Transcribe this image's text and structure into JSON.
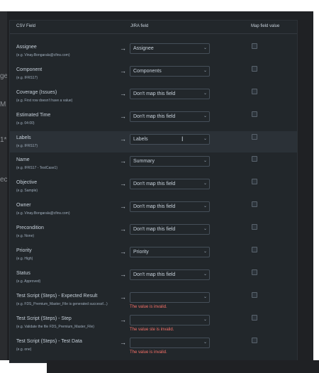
{
  "header": {
    "csv_field": "CSV Field",
    "jira_field": "JIRA field",
    "map_value": "Map field value"
  },
  "background_text": [
    "ge",
    "M",
    "1*",
    "ec"
  ],
  "arrow_glyph": "→",
  "chevron_glyph": "⌄",
  "rows": [
    {
      "label": "Assignee",
      "example": "(e.g. Vinay.Bongarala@cfins.com)",
      "value": "Assignee",
      "error": "",
      "checked": false
    },
    {
      "label": "Component",
      "example": "(e.g. IFRS17)",
      "value": "Components",
      "error": "",
      "checked": false
    },
    {
      "label": "Coverage (Issues)",
      "example": "(e.g. First row doesn't have a value)",
      "value": "Don't map this field",
      "error": "",
      "checked": false
    },
    {
      "label": "Estimated Time",
      "example": "(e.g. 04:00)",
      "value": "Don't map this field",
      "error": "",
      "checked": false
    },
    {
      "label": "Labels",
      "example": "(e.g. IFRS17)",
      "value": "Labels",
      "error": "",
      "checked": false
    },
    {
      "label": "Name",
      "example": "(e.g. IFRS17 - TestCase1)",
      "value": "Summary",
      "error": "",
      "checked": false
    },
    {
      "label": "Objective",
      "example": "(e.g. Sample)",
      "value": "Don't map this field",
      "error": "",
      "checked": false
    },
    {
      "label": "Owner",
      "example": "(e.g. Vinay.Bongarala@cfins.com)",
      "value": "Don't map this field",
      "error": "",
      "checked": false
    },
    {
      "label": "Precondition",
      "example": "(e.g. None)",
      "value": "Don't map this field",
      "error": "",
      "checked": false
    },
    {
      "label": "Priority",
      "example": "(e.g. High)",
      "value": "Priority",
      "error": "",
      "checked": false
    },
    {
      "label": "Status",
      "example": "(e.g. Approved)",
      "value": "Don't map this field",
      "error": "",
      "checked": false
    },
    {
      "label": "Test Script (Steps) - Expected Result",
      "example": "(e.g. FDS_Premium_Master_File is generated successf...)",
      "value": "",
      "error": "The value is invalid.",
      "checked": false
    },
    {
      "label": "Test Script (Steps) - Step",
      "example": "(e.g. Validate the file FDS_Premium_Master_File)",
      "value": "",
      "error": "The value ste is invalid.",
      "checked": false
    },
    {
      "label": "Test Script (Steps) - Test Data",
      "example": "(e.g. one)",
      "value": "",
      "error": "The value is invalid.",
      "checked": false
    }
  ],
  "colors": {
    "panel_bg": "#22272b",
    "highlight_row_bg": "#2b3137",
    "text": "#c7d1db",
    "subtle_text": "#9fadbc",
    "error": "#f87168"
  }
}
